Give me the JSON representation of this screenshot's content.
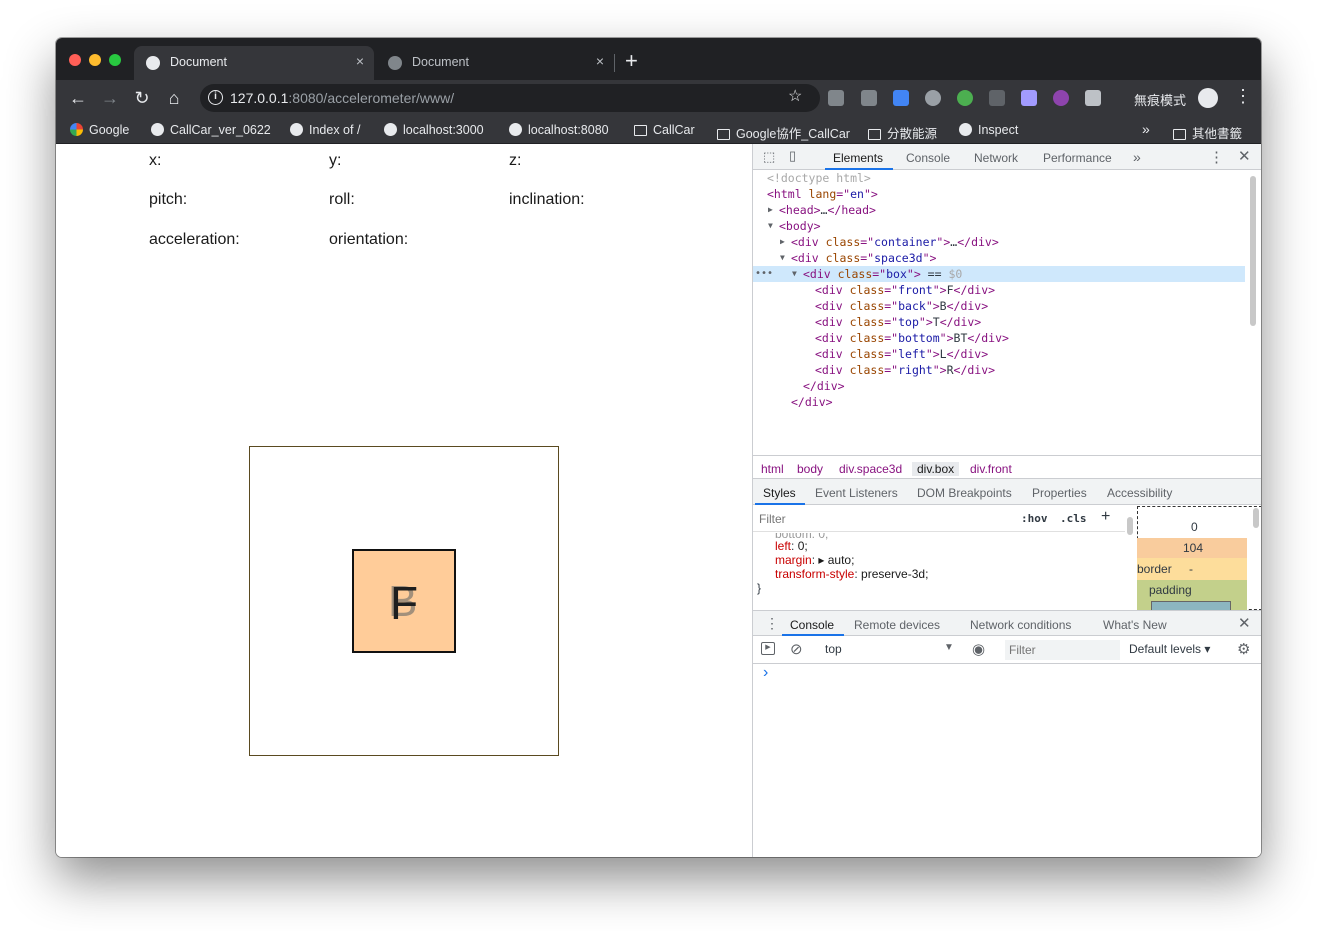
{
  "colors": {
    "chrome_dark": "#202124",
    "chrome_toolbar": "#35363a",
    "box_fill": "#ffcc99",
    "accent": "#1a73e8"
  },
  "tabs": [
    {
      "title": "Document",
      "active": true,
      "close": "×"
    },
    {
      "title": "Document",
      "active": false,
      "close": "×"
    }
  ],
  "new_tab": "+",
  "toolbar": {
    "back": "←",
    "forward": "→",
    "reload": "↻",
    "home": "⌂",
    "url_host": "127.0.0.1",
    "url_rest": ":8080/accelerometer/www/",
    "star": "☆",
    "incognito_label": "無痕模式",
    "menu": "⋮"
  },
  "bookmarks": [
    {
      "label": "Google",
      "icon": "google-icon"
    },
    {
      "label": "CallCar_ver_0622",
      "icon": "elephant-icon"
    },
    {
      "label": "Index of /",
      "icon": "elephant-icon"
    },
    {
      "label": "localhost:3000",
      "icon": "globe-icon"
    },
    {
      "label": "localhost:8080",
      "icon": "globe-icon"
    },
    {
      "label": "CallCar",
      "icon": "folder-icon"
    },
    {
      "label": "Google協作_CallCar",
      "icon": "folder-icon"
    },
    {
      "label": "分散能源",
      "icon": "folder-icon"
    },
    {
      "label": "Inspect",
      "icon": "globe-icon"
    }
  ],
  "bookmarks_more": "»",
  "bookmarks_other": "其他書籤",
  "page": {
    "x": "x:",
    "y": "y:",
    "z": "z:",
    "pitch": "pitch:",
    "roll": "roll:",
    "inclination": "inclination:",
    "acceleration": "acceleration:",
    "orientation": "orientation:",
    "face_front": "F",
    "face_back": "B"
  },
  "devtools": {
    "tabs": [
      "Elements",
      "Console",
      "Network",
      "Performance"
    ],
    "more": "»",
    "dom_lines": [
      {
        "indent": 0,
        "parts": [
          [
            "cm",
            "<!doctype html>"
          ]
        ]
      },
      {
        "indent": 0,
        "parts": [
          [
            "tg",
            "<html "
          ],
          [
            "at",
            "lang"
          ],
          [
            "tg",
            "=\""
          ],
          [
            "av",
            "en"
          ],
          [
            "tg",
            "\">"
          ]
        ]
      },
      {
        "indent": 1,
        "arrow": "▶",
        "parts": [
          [
            "tg",
            "<head>"
          ],
          [
            "tx",
            "…"
          ],
          [
            "tg",
            "</head>"
          ]
        ]
      },
      {
        "indent": 1,
        "arrow": "▼",
        "parts": [
          [
            "tg",
            "<body>"
          ]
        ]
      },
      {
        "indent": 2,
        "arrow": "▶",
        "parts": [
          [
            "tg",
            "<div "
          ],
          [
            "at",
            "class"
          ],
          [
            "tg",
            "=\""
          ],
          [
            "av",
            "container"
          ],
          [
            "tg",
            "\">"
          ],
          [
            "tx",
            "…"
          ],
          [
            "tg",
            "</div>"
          ]
        ]
      },
      {
        "indent": 2,
        "arrow": "▼",
        "parts": [
          [
            "tg",
            "<div "
          ],
          [
            "at",
            "class"
          ],
          [
            "tg",
            "=\""
          ],
          [
            "av",
            "space3d"
          ],
          [
            "tg",
            "\">"
          ]
        ]
      },
      {
        "indent": 3,
        "arrow": "▼",
        "parts": [
          [
            "tg",
            "<div "
          ],
          [
            "at",
            "class"
          ],
          [
            "tg",
            "=\""
          ],
          [
            "av",
            "box"
          ],
          [
            "tg",
            "\">"
          ],
          [
            "tx",
            " == "
          ],
          [
            "cm",
            "$0"
          ]
        ]
      },
      {
        "indent": 4,
        "parts": [
          [
            "tg",
            "<div "
          ],
          [
            "at",
            "class"
          ],
          [
            "tg",
            "=\""
          ],
          [
            "av",
            "front"
          ],
          [
            "tg",
            "\">"
          ],
          [
            "tx",
            "F"
          ],
          [
            "tg",
            "</div>"
          ]
        ]
      },
      {
        "indent": 4,
        "parts": [
          [
            "tg",
            "<div "
          ],
          [
            "at",
            "class"
          ],
          [
            "tg",
            "=\""
          ],
          [
            "av",
            "back"
          ],
          [
            "tg",
            "\">"
          ],
          [
            "tx",
            "B"
          ],
          [
            "tg",
            "</div>"
          ]
        ]
      },
      {
        "indent": 4,
        "parts": [
          [
            "tg",
            "<div "
          ],
          [
            "at",
            "class"
          ],
          [
            "tg",
            "=\""
          ],
          [
            "av",
            "top"
          ],
          [
            "tg",
            "\">"
          ],
          [
            "tx",
            "T"
          ],
          [
            "tg",
            "</div>"
          ]
        ]
      },
      {
        "indent": 4,
        "parts": [
          [
            "tg",
            "<div "
          ],
          [
            "at",
            "class"
          ],
          [
            "tg",
            "=\""
          ],
          [
            "av",
            "bottom"
          ],
          [
            "tg",
            "\">"
          ],
          [
            "tx",
            "BT"
          ],
          [
            "tg",
            "</div>"
          ]
        ]
      },
      {
        "indent": 4,
        "parts": [
          [
            "tg",
            "<div "
          ],
          [
            "at",
            "class"
          ],
          [
            "tg",
            "=\""
          ],
          [
            "av",
            "left"
          ],
          [
            "tg",
            "\">"
          ],
          [
            "tx",
            "L"
          ],
          [
            "tg",
            "</div>"
          ]
        ]
      },
      {
        "indent": 4,
        "parts": [
          [
            "tg",
            "<div "
          ],
          [
            "at",
            "class"
          ],
          [
            "tg",
            "=\""
          ],
          [
            "av",
            "right"
          ],
          [
            "tg",
            "\">"
          ],
          [
            "tx",
            "R"
          ],
          [
            "tg",
            "</div>"
          ]
        ]
      },
      {
        "indent": 3,
        "parts": [
          [
            "tg",
            "</div>"
          ]
        ]
      },
      {
        "indent": 2,
        "parts": [
          [
            "tg",
            "</div>"
          ]
        ]
      }
    ],
    "breadcrumbs": [
      "html",
      "body",
      "div.space3d",
      "div.box",
      "div.front"
    ],
    "style_tabs": [
      "Styles",
      "Event Listeners",
      "DOM Breakpoints",
      "Properties",
      "Accessibility"
    ],
    "filter_placeholder": "Filter",
    "hov": ":hov",
    "cls": ".cls",
    "plus": "+",
    "css_lines": [
      {
        "prop": "left",
        "value": "0;"
      },
      {
        "prop": "margin",
        "value": "▸ auto;"
      },
      {
        "prop": "transform-style",
        "value": "preserve-3d;"
      }
    ],
    "css_close": "}",
    "box_model": {
      "margin_value": "0",
      "border_fill_value": "104",
      "border_label": "border",
      "border_value": "-",
      "padding_label": "padding"
    },
    "drawer_tabs": [
      "Console",
      "Remote devices",
      "Network conditions",
      "What's New"
    ],
    "console_context": "top",
    "console_filter_placeholder": "Filter",
    "console_levels": "Default levels ▾",
    "console_prompt": "›"
  }
}
